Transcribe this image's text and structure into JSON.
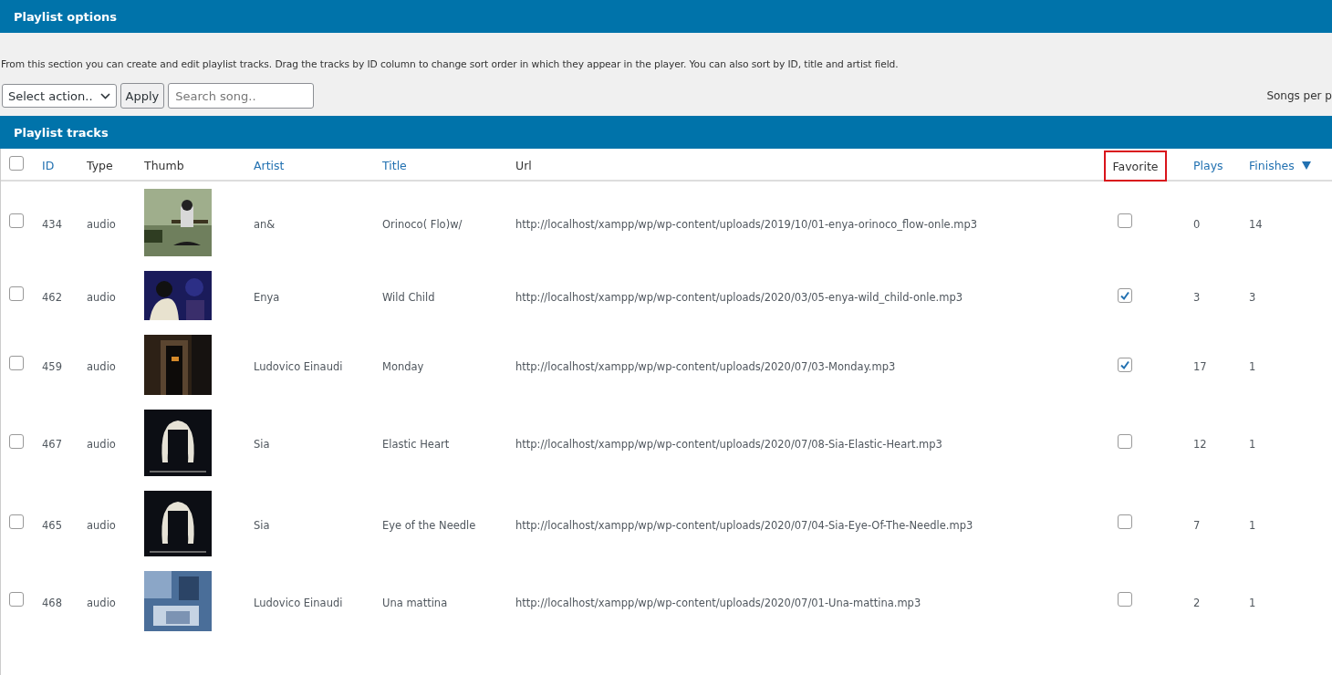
{
  "options_panel": {
    "title": "Playlist options",
    "description": "From this section you can create and edit playlist tracks. Drag the tracks by ID column to change sort order in which they appear in the player. You can also sort by ID, title and artist field.",
    "action_select": {
      "value": "Select action.."
    },
    "apply_button": "Apply",
    "search": {
      "placeholder": "Search song.."
    },
    "songs_per_page_label": "Songs per p"
  },
  "tracks_panel": {
    "title": "Playlist tracks",
    "select_all": {
      "checked": false
    },
    "columns": [
      {
        "label": "ID",
        "sortable": true,
        "sorted_desc": false,
        "highlighted": false
      },
      {
        "label": "Type",
        "sortable": false,
        "sorted_desc": false,
        "highlighted": false
      },
      {
        "label": "Thumb",
        "sortable": false,
        "sorted_desc": false,
        "highlighted": false
      },
      {
        "label": "Artist",
        "sortable": true,
        "sorted_desc": false,
        "highlighted": false
      },
      {
        "label": "Title",
        "sortable": true,
        "sorted_desc": false,
        "highlighted": false
      },
      {
        "label": "Url",
        "sortable": false,
        "sorted_desc": false,
        "highlighted": false
      },
      {
        "label": "Favorite",
        "sortable": false,
        "sorted_desc": false,
        "highlighted": true
      },
      {
        "label": "Plays",
        "sortable": true,
        "sorted_desc": false,
        "highlighted": false
      },
      {
        "label": "Finishes",
        "sortable": true,
        "sorted_desc": true,
        "highlighted": false
      }
    ],
    "rows": [
      {
        "checked": false,
        "id": "434",
        "type": "audio",
        "artist": "an&",
        "title": "Orinoco( Flo)w/",
        "url": "http://localhost/xampp/wp/wp-content/uploads/2019/10/01-enya-orinoco_flow-onle.mp3",
        "favorite": false,
        "plays": "0",
        "finishes": "14"
      },
      {
        "checked": false,
        "id": "462",
        "type": "audio",
        "artist": "Enya",
        "title": "Wild Child",
        "url": "http://localhost/xampp/wp/wp-content/uploads/2020/03/05-enya-wild_child-onle.mp3",
        "favorite": true,
        "plays": "3",
        "finishes": "3"
      },
      {
        "checked": false,
        "id": "459",
        "type": "audio",
        "artist": "Ludovico Einaudi",
        "title": "Monday",
        "url": "http://localhost/xampp/wp/wp-content/uploads/2020/07/03-Monday.mp3",
        "favorite": true,
        "plays": "17",
        "finishes": "1"
      },
      {
        "checked": false,
        "id": "467",
        "type": "audio",
        "artist": "Sia",
        "title": "Elastic Heart",
        "url": "http://localhost/xampp/wp/wp-content/uploads/2020/07/08-Sia-Elastic-Heart.mp3",
        "favorite": false,
        "plays": "12",
        "finishes": "1"
      },
      {
        "checked": false,
        "id": "465",
        "type": "audio",
        "artist": "Sia",
        "title": "Eye of the Needle",
        "url": "http://localhost/xampp/wp/wp-content/uploads/2020/07/04-Sia-Eye-Of-The-Needle.mp3",
        "favorite": false,
        "plays": "7",
        "finishes": "1"
      },
      {
        "checked": false,
        "id": "468",
        "type": "audio",
        "artist": "Ludovico Einaudi",
        "title": "Una mattina",
        "url": "http://localhost/xampp/wp/wp-content/uploads/2020/07/01-Una-mattina.mp3",
        "favorite": false,
        "plays": "2",
        "finishes": "1"
      }
    ]
  }
}
